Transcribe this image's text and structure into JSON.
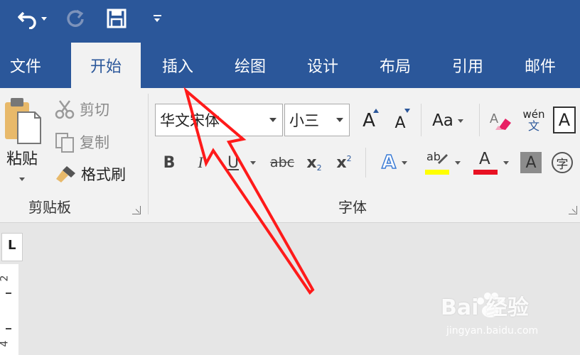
{
  "tabs": [
    {
      "label": "文件",
      "active": false
    },
    {
      "label": "开始",
      "active": true
    },
    {
      "label": "插入",
      "active": false
    },
    {
      "label": "绘图",
      "active": false
    },
    {
      "label": "设计",
      "active": false
    },
    {
      "label": "布局",
      "active": false
    },
    {
      "label": "引用",
      "active": false
    },
    {
      "label": "邮件",
      "active": false
    }
  ],
  "clipboard": {
    "paste_label": "粘贴",
    "cut_label": "剪切",
    "copy_label": "复制",
    "format_painter_label": "格式刷",
    "group_label": "剪贴板"
  },
  "font": {
    "font_name": "华文宋体",
    "font_size": "小三",
    "group_label": "字体",
    "bold": "B",
    "italic": "I",
    "underline": "U",
    "strike": "abc",
    "subscript_base": "x",
    "subscript_mark": "2",
    "superscript_base": "x",
    "superscript_mark": "2",
    "grow": "A",
    "shrink": "A",
    "change_case": "Aa",
    "phonetic_top": "wén",
    "phonetic_bottom": "文",
    "char_border": "A",
    "text_effect": "A",
    "highlight_text": "ab",
    "font_color": "A",
    "shading": "A",
    "enclose": "字"
  },
  "ruler": {
    "corner": "L",
    "num_2": "2",
    "num_4": "4"
  },
  "watermark": {
    "main": "Bai 经验",
    "sub": "jingyan.baidu.com"
  },
  "colors": {
    "brand": "#2b579a",
    "highlight": "#ffff00",
    "font_color": "#e81123",
    "arrow": "#ff1a1a"
  }
}
